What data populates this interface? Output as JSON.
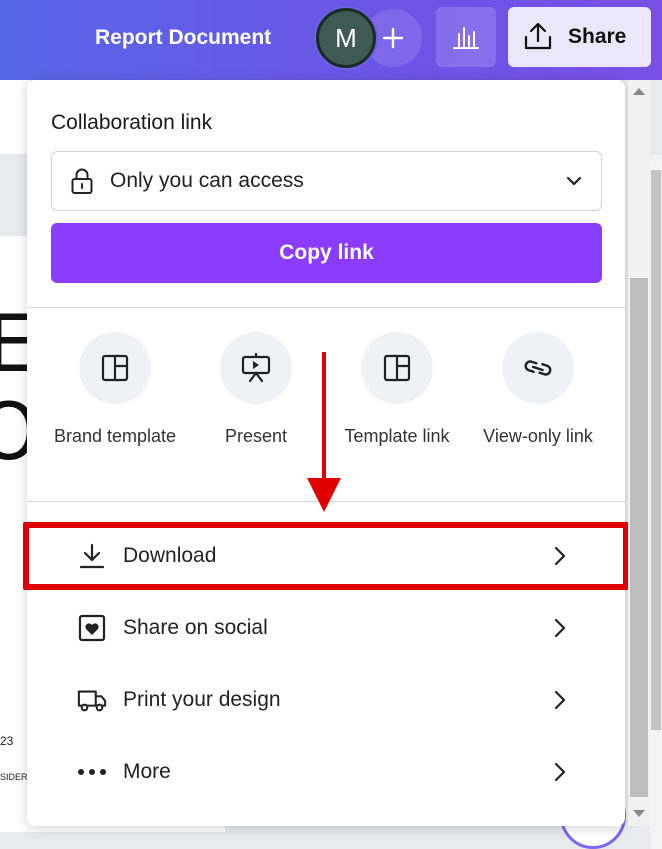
{
  "header": {
    "doc_title": "Report Document",
    "avatar_initial": "M",
    "share_label": "Share"
  },
  "canvas": {
    "text_e": "E",
    "text_o": "O",
    "text_23": "23",
    "text_sider": "SIDER"
  },
  "share_panel": {
    "collab_label": "Collaboration link",
    "access_value": "Only you can access",
    "copy_link_label": "Copy link",
    "quick_actions": [
      {
        "label": "Brand template",
        "icon": "brand-template-icon"
      },
      {
        "label": "Present",
        "icon": "presentation-icon"
      },
      {
        "label": "Template link",
        "icon": "template-link-icon"
      },
      {
        "label": "View-only link",
        "icon": "link-icon"
      }
    ],
    "menu": [
      {
        "label": "Download",
        "icon": "download-icon",
        "highlighted": true
      },
      {
        "label": "Share on social",
        "icon": "heart-icon"
      },
      {
        "label": "Print your design",
        "icon": "truck-icon"
      },
      {
        "label": "More",
        "icon": "more-dots-icon"
      }
    ]
  },
  "colors": {
    "accent": "#8b3dff",
    "annotation": "#e00000",
    "header_gradient_start": "#5867e8",
    "header_gradient_end": "#7a4fe6"
  }
}
